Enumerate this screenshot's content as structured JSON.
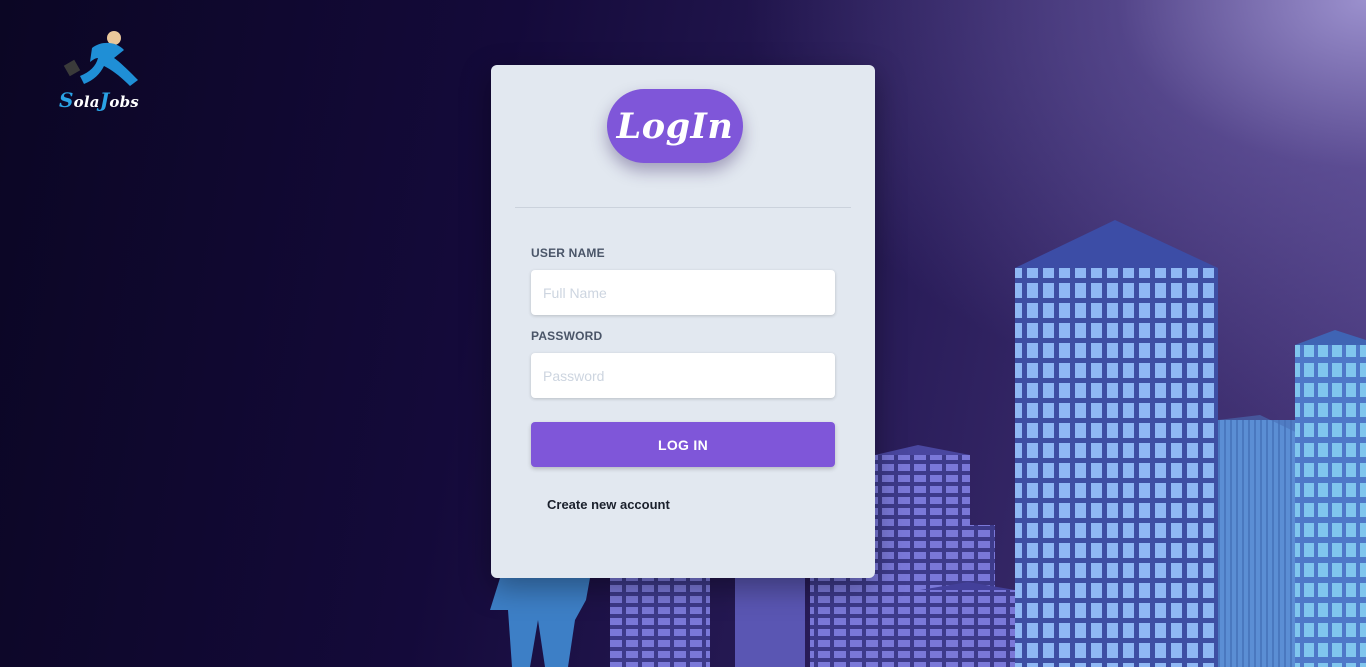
{
  "logo": {
    "first_letter": "S",
    "middle": "ola",
    "second_letter": "J",
    "rest": "obs",
    "icon": "running-man-icon",
    "accent_color": "#2aa3e6"
  },
  "login_card": {
    "title": "LogIn",
    "username": {
      "label": "USER NAME",
      "placeholder": "Full Name",
      "value": ""
    },
    "password": {
      "label": "PASSWORD",
      "placeholder": "Password",
      "value": ""
    },
    "login_button": "LOG IN",
    "create_account_link": "Create new account"
  },
  "colors": {
    "accent": "#7f56d9",
    "card_background": "#e2e8f0",
    "page_background": "#140a3a"
  }
}
